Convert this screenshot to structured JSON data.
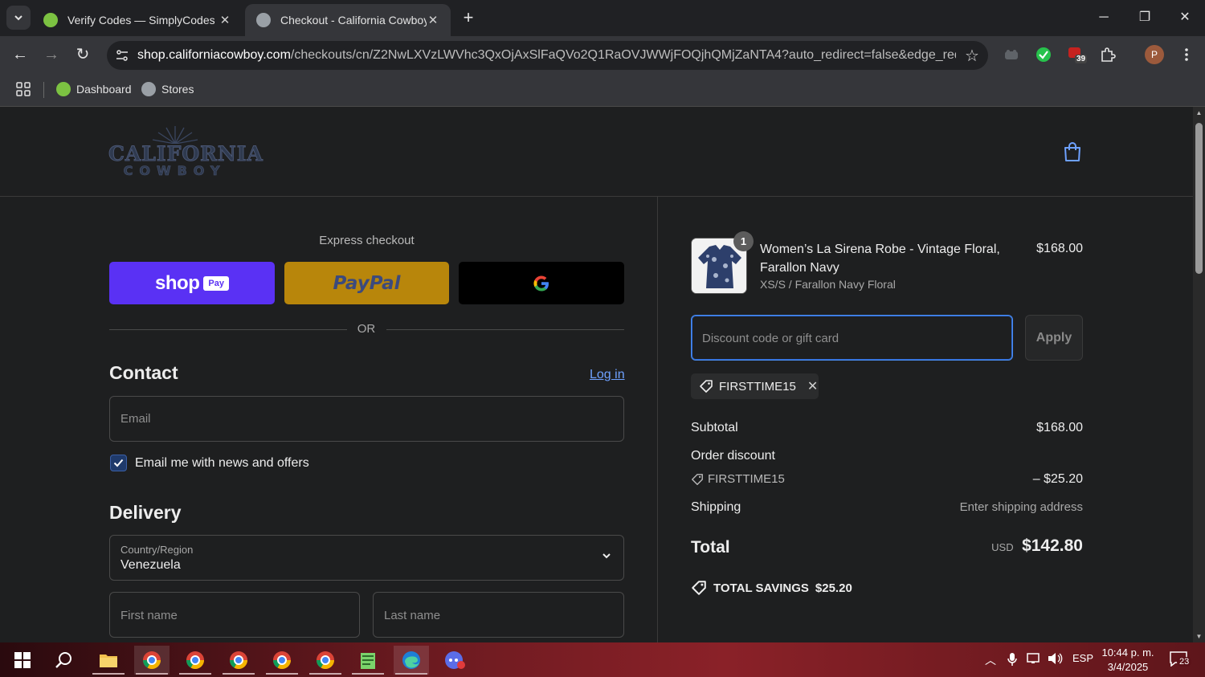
{
  "browser": {
    "tabs": [
      {
        "title": "Verify Codes — SimplyCodes",
        "active": false
      },
      {
        "title": "Checkout - California Cowboy",
        "active": true
      }
    ],
    "url_host": "shop.californiacowboy.com",
    "url_path": "/checkouts/cn/Z2NwLXVzLWVhc3QxOjAxSlFaQVo2Q1RaOVJWWjFOQjhQMjZaNTA4?auto_redirect=false&edge_redirect...",
    "extension_badge": "39",
    "profile_initial": "P",
    "bookmarks": [
      {
        "label": "Dashboard"
      },
      {
        "label": "Stores"
      }
    ]
  },
  "store": {
    "logo_line1": "CALIFORNIA",
    "logo_line2": "COWBOY"
  },
  "checkout": {
    "express_title": "Express checkout",
    "shop_pay_label": "shop",
    "shop_pay_badge": "Pay",
    "paypal_label": "PayPal",
    "or_label": "OR",
    "contact_heading": "Contact",
    "login_link": "Log in",
    "email_placeholder": "Email",
    "newsletter_label": "Email me with news and offers",
    "delivery_heading": "Delivery",
    "country_label": "Country/Region",
    "country_value": "Venezuela",
    "first_name_placeholder": "First name",
    "last_name_placeholder": "Last name"
  },
  "summary": {
    "product": {
      "quantity": "1",
      "name": "Women’s La Sirena Robe - Vintage Floral, Farallon Navy",
      "variant": "XS/S / Farallon Navy Floral",
      "price": "$168.00"
    },
    "discount_placeholder": "Discount code or gift card",
    "apply_label": "Apply",
    "applied_code": "FIRSTTIME15",
    "subtotal_label": "Subtotal",
    "subtotal_value": "$168.00",
    "order_discount_label": "Order discount",
    "discount_code": "FIRSTTIME15",
    "discount_value": "– $25.20",
    "shipping_label": "Shipping",
    "shipping_value": "Enter shipping address",
    "total_label": "Total",
    "currency": "USD",
    "total_value": "$142.80",
    "savings_label": "TOTAL SAVINGS",
    "savings_value": "$25.20"
  },
  "taskbar": {
    "language": "ESP",
    "time": "10:44 p. m.",
    "date": "3/4/2025",
    "notifications": "23"
  },
  "colors": {
    "shop_pay": "#5a31f4",
    "paypal": "#b8860b",
    "link": "#6ea1ff",
    "focus_border": "#4a8cf0"
  }
}
